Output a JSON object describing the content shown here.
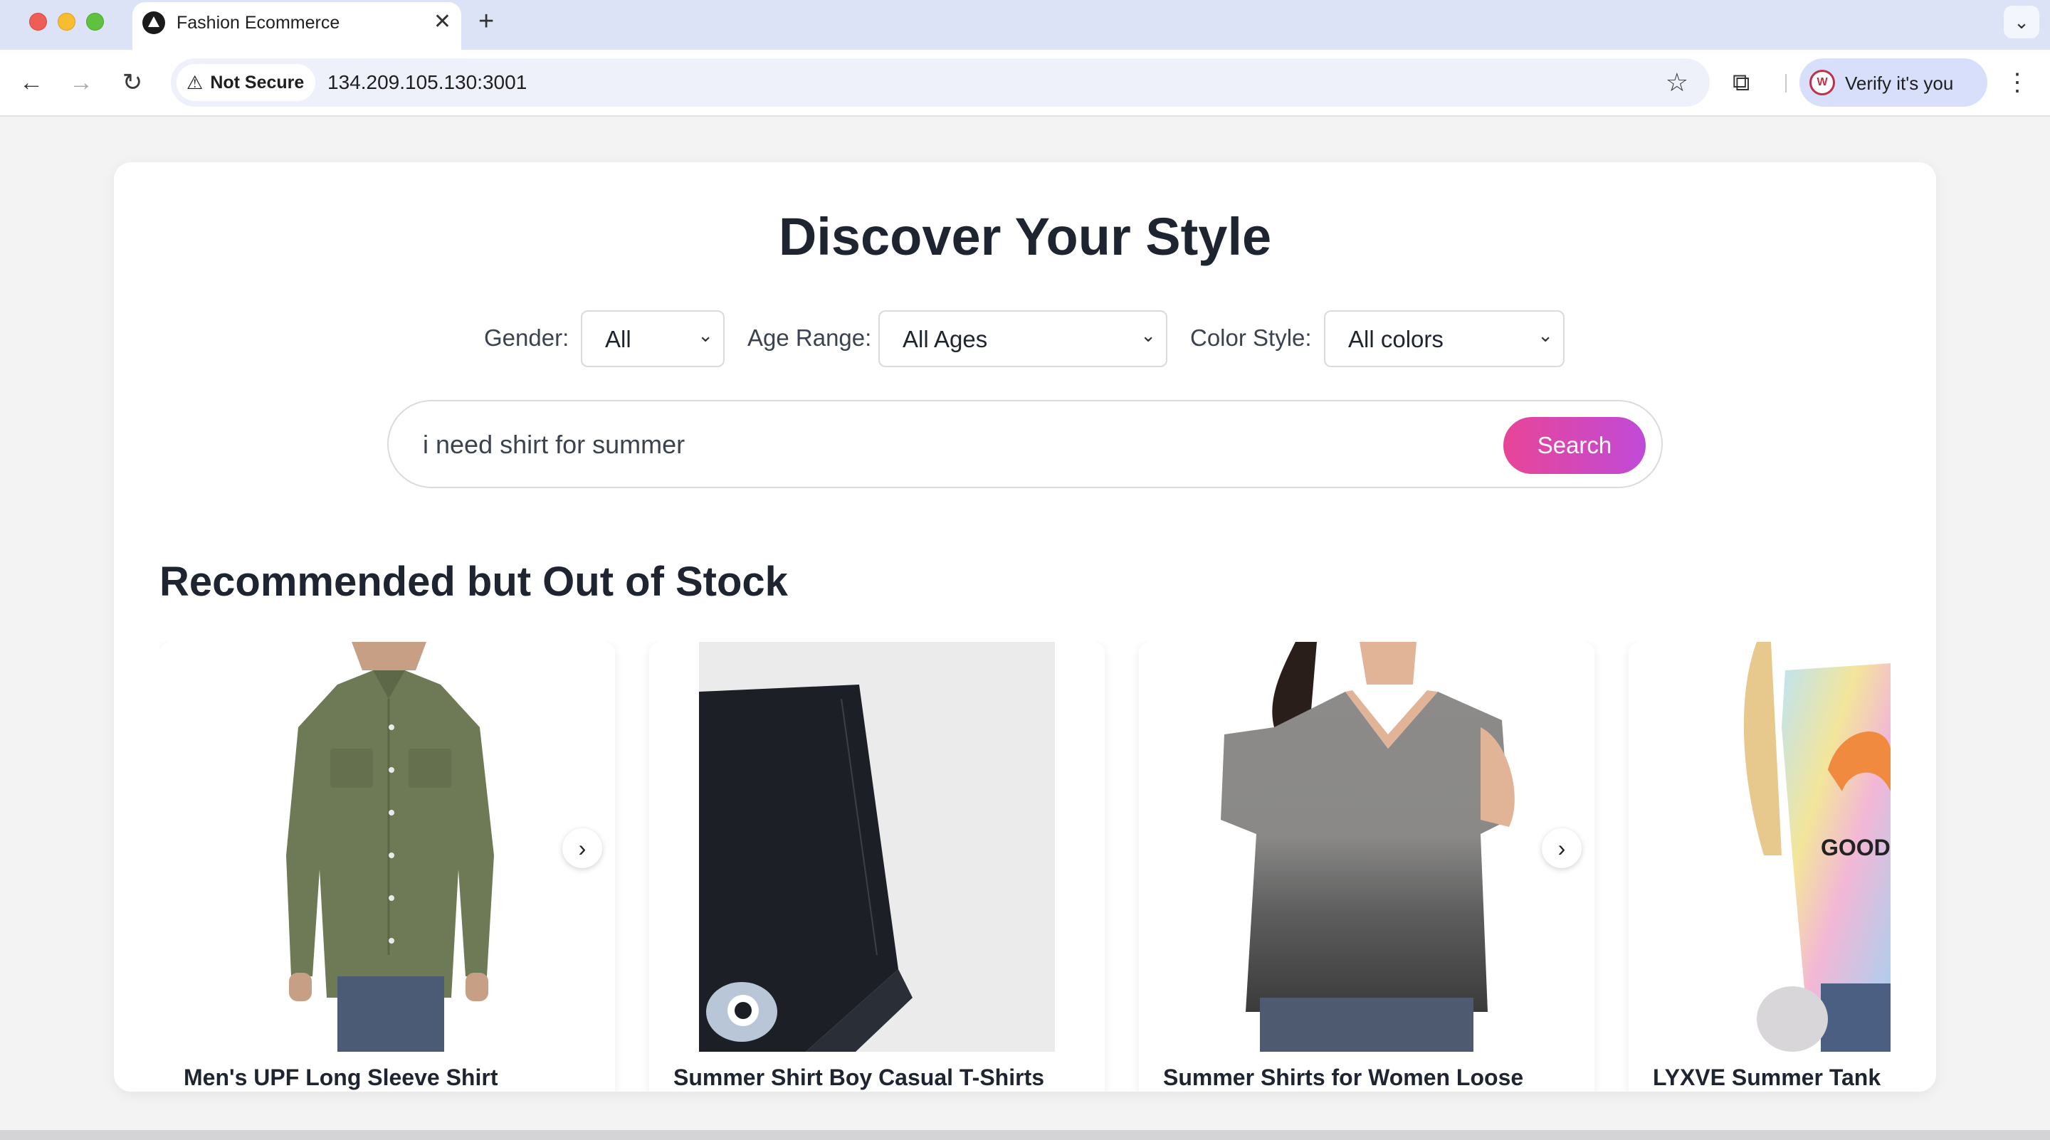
{
  "browser": {
    "tab_title": "Fashion Ecommerce",
    "tab_close": "✕",
    "new_tab": "+",
    "tab_menu": "⌄",
    "security_label": "Not Secure",
    "url": "134.209.105.130:3001",
    "profile_button": "Verify it's you",
    "profile_initial": "W",
    "icons": {
      "back": "←",
      "forward": "→",
      "reload": "↻",
      "warning": "⚠",
      "star": "☆",
      "extensions": "⧉",
      "menu": "⋮"
    }
  },
  "page": {
    "headline": "Discover Your Style",
    "filters": {
      "gender_label": "Gender:",
      "gender_value": "All",
      "age_label": "Age Range:",
      "age_value": "All Ages",
      "color_label": "Color Style:",
      "color_value": "All colors"
    },
    "search": {
      "query": "i need shirt for summer",
      "button_label": "Search"
    },
    "section_title": "Recommended but Out of Stock",
    "products": [
      {
        "name": "Men's UPF Long Sleeve Shirt"
      },
      {
        "name": "Summer Shirt Boy Casual T-Shirts"
      },
      {
        "name": "Summer Shirts for Women Loose"
      },
      {
        "name": "LYXVE Summer Tank"
      }
    ],
    "carousel": {
      "next_glyph": "›"
    }
  },
  "colors": {
    "accent_gradient_start": "#e84597",
    "accent_gradient_end": "#c04ad8",
    "tab_strip": "#dde3f7",
    "heading_text": "#1e2530"
  }
}
